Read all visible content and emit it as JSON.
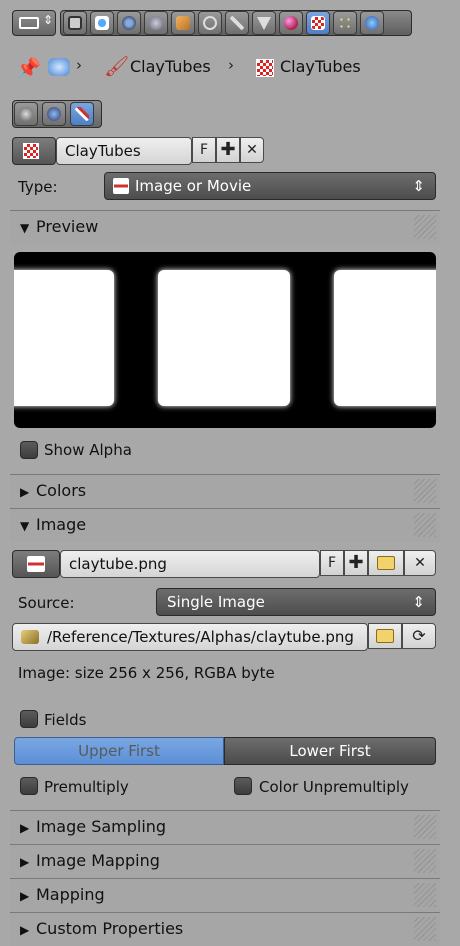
{
  "breadcrumb": {
    "brush_name": "ClayTubes",
    "texture_name": "ClayTubes",
    "separator": "›"
  },
  "datablock": {
    "name": "ClayTubes",
    "fake_user": "F"
  },
  "type_row": {
    "label": "Type:",
    "value": "Image or Movie"
  },
  "preview": {
    "title": "Preview",
    "show_alpha_label": "Show Alpha"
  },
  "colors_panel": {
    "title": "Colors"
  },
  "image_panel": {
    "title": "Image",
    "image_name": "claytube.png",
    "fake_user": "F",
    "source_label": "Source:",
    "source_value": "Single Image",
    "filepath": "/Reference/Textures/Alphas/claytube.png",
    "info": "Image: size 256 x 256, RGBA byte",
    "fields_label": "Fields",
    "upper_first": "Upper First",
    "lower_first": "Lower First",
    "premultiply_label": "Premultiply",
    "color_unpremultiply_label": "Color Unpremultiply"
  },
  "collapsed_panels": {
    "image_sampling": "Image Sampling",
    "image_mapping": "Image Mapping",
    "mapping": "Mapping",
    "custom_properties": "Custom Properties"
  },
  "colors": {
    "accent": "#5b8fd6",
    "panel_bg": "#a8a8a8",
    "dark_field": "#555555"
  }
}
